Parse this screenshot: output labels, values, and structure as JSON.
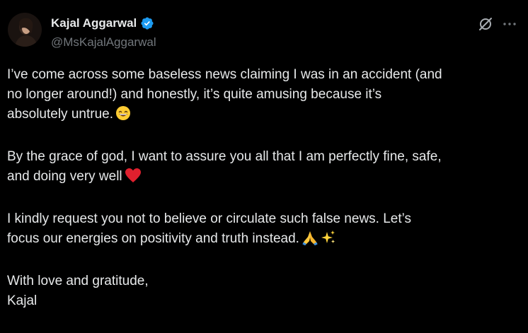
{
  "author": {
    "display_name": "Kajal Aggarwal",
    "handle": "@MsKajalAggarwal",
    "verified": true,
    "verified_color": "#1d9bf0",
    "avatar_icon": "profile-photo"
  },
  "actions": {
    "grok_icon": "grok-icon",
    "more_icon": "more-options-icon",
    "icon_color": "#71767b"
  },
  "tweet": {
    "p1_l1": "I’ve come across some baseless news claiming I was in an accident (and",
    "p1_l2": "no longer around!) and honestly, it’s quite amusing because it’s",
    "p1_l3": "absolutely untrue.",
    "p1_emoji": "grinning-face-with-smiling-eyes",
    "p2_l1": "By the grace of god, I want to assure you all that I am perfectly fine, safe,",
    "p2_l2": "and doing very well",
    "p2_emoji": "red-heart",
    "p3_l1": "I kindly request you not to believe or circulate such false news. Let’s",
    "p3_l2": "focus our energies on positivity and truth instead.",
    "p3_emojis": [
      "folded-hands",
      "sparkles"
    ],
    "p4_l1": "With love and gratitude,",
    "p4_l2": "Kajal"
  },
  "colors": {
    "background": "#000000",
    "text": "#e7e9ea",
    "secondary": "#71767b"
  }
}
